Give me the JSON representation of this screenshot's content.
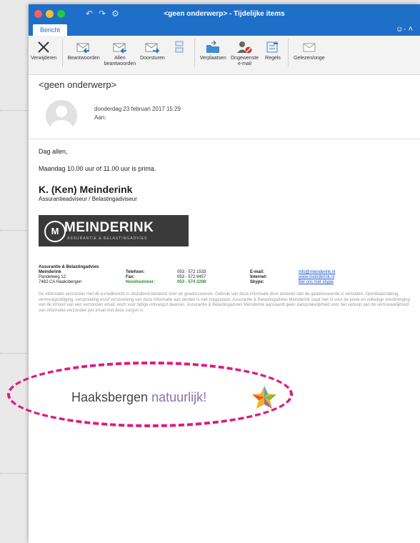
{
  "window": {
    "title": "<geen onderwerp> - Tijdelijke items",
    "active_tab": "Bericht"
  },
  "ribbon": {
    "buttons": [
      {
        "label": "Verwijderen",
        "icon": "delete-x-icon"
      },
      {
        "label": "Beantwoorden",
        "icon": "reply-icon"
      },
      {
        "label": "Allen\nbeantwoorden",
        "icon": "reply-all-icon"
      },
      {
        "label": "Doorsturen",
        "icon": "forward-icon"
      },
      {
        "label": "Verplaatsen",
        "icon": "move-folder-icon"
      },
      {
        "label": "Ongewenste\ne-mail",
        "icon": "junk-mail-icon"
      },
      {
        "label": "Regels",
        "icon": "rules-icon"
      },
      {
        "label": "Gelezen/onge",
        "icon": "envelope-icon"
      }
    ]
  },
  "message": {
    "subject": "<geen onderwerp>",
    "date": "donderdag 23 februari 2017 15:29",
    "to_label": "Aan:",
    "greeting": "Dag allen,",
    "body": "Maandag 10.00 uur of 11.00 uur is prima."
  },
  "signature": {
    "name": "K. (Ken) Meinderink",
    "role": "Assurantieadviseur / Belastingadviseur",
    "logo_text": "MEINDERINK",
    "logo_tagline": "ASSURANTIE & BELASTINGADVIES",
    "company": "Assurantie & Belastingadvies",
    "company_short": "Meinderink",
    "street": "Pandelweg 12",
    "city": "7482 CA Haaksbergen",
    "phone_label": "Telefoon:",
    "fax_label": "Fax:",
    "emergency_label": "Noodnummer:",
    "phone": "053 - 572 1533",
    "fax": "053 - 572 9457",
    "emergency": "053 - 574 2208",
    "email_label": "E-mail:",
    "internet_label": "Internet:",
    "skype_label": "Skype:",
    "email": "info@meinderink.nl",
    "internet": "www.meinderink.nl",
    "skype": "Bel ons met skype"
  },
  "disclaimer": "De informatie verzonden met dit e-mailbericht is uitsluitend bestemd voor de geadresseerde. Gebruik van deze informatie door anderen dan de geadresseerde is verboden. Openbaarmaking, vermenigvuldiging, verspreiding en/of verstrekking van deze informatie aan derden is niet toegestaan. Assurantie & Belastingadvies Meinderink staat niet in voor de juiste en volledige overbrenging van de inhoud van een verzonden email, noch voor tijdige ontvangst daarvan. Assurantie & Belastingadvies Meinderink aanvaardt geen aansprakelijkheid voor het verloop van de vertrouwelijkheid van informatie verzonden per email met deze zorgen is.",
  "slogan": {
    "part1": "Haaksbergen",
    "part2": "natuurlijk!"
  },
  "colors": {
    "titlebar": "#1e6fc7",
    "annotation": "#e0197d"
  }
}
